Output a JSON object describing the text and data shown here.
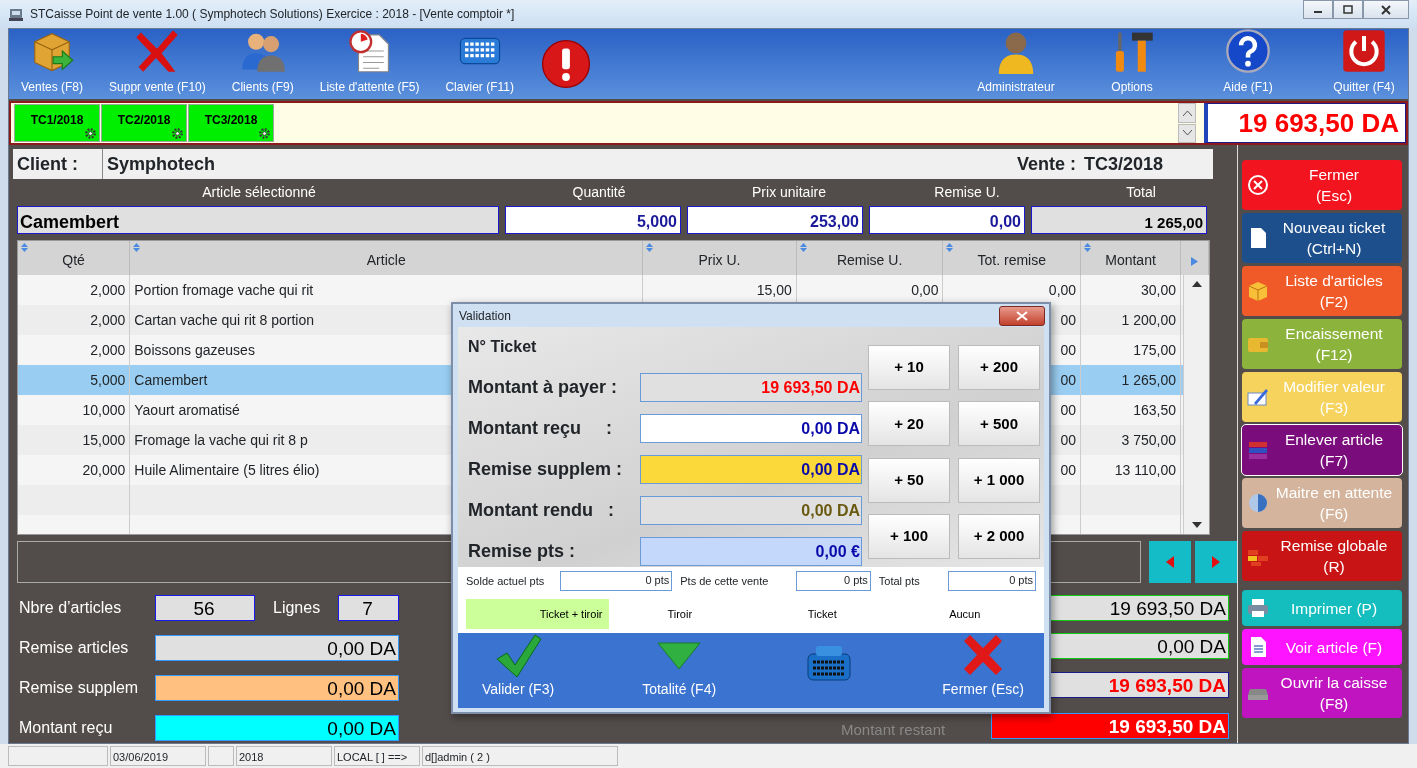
{
  "window": {
    "title": "STCaisse Point de vente 1.00 ( Symphotech Solutions) Exercice : 2018 - [Vente comptoir  *]"
  },
  "toolbar": {
    "left": [
      {
        "label": "Ventes (F8)",
        "kind": "sales"
      },
      {
        "label": "Suppr vente (F10)",
        "kind": "delete"
      },
      {
        "label": "Clients (F9)",
        "kind": "clients"
      },
      {
        "label": "Liste d'attente (F5)",
        "kind": "waiting"
      },
      {
        "label": "Clavier (F11)",
        "kind": "keyboard"
      },
      {
        "kind": "alert"
      }
    ],
    "right": [
      {
        "label": "Administrateur",
        "kind": "admin"
      },
      {
        "label": "Options",
        "kind": "options"
      },
      {
        "label": "Aide (F1)",
        "kind": "help"
      },
      {
        "label": "Quitter (F4)",
        "kind": "quit"
      }
    ]
  },
  "ticket_tabs": [
    {
      "label": "TC1/2018"
    },
    {
      "label": "TC2/2018"
    },
    {
      "label": "TC3/2018"
    }
  ],
  "total_display": "19 693,50 DA",
  "client": {
    "label": "Client :",
    "name": "Symphotech"
  },
  "sale": {
    "label": "Vente :",
    "number": "TC3/2018"
  },
  "article_entry": {
    "headers": [
      "Article sélectionné",
      "Quantité",
      "Prix unitaire",
      "Remise U.",
      "Total"
    ],
    "values": [
      "Camembert",
      "5,000",
      "253,00",
      "0,00",
      "1 265,00"
    ]
  },
  "table": {
    "columns": [
      "Qté",
      "Article",
      "Prix U.",
      "Remise U.",
      "Tot. remise",
      "Montant"
    ],
    "rows": [
      {
        "cells": [
          "2,000",
          "Portion fromage vache qui rit",
          "15,00",
          "0,00",
          "0,00",
          "30,00"
        ],
        "selected": false
      },
      {
        "cells": [
          "2,000",
          "Cartan vache qui rit 8 portion",
          "",
          "",
          "00",
          "1 200,00"
        ],
        "selected": false
      },
      {
        "cells": [
          "2,000",
          "Boissons gazeuses",
          "",
          "",
          "00",
          "175,00"
        ],
        "selected": false
      },
      {
        "cells": [
          "5,000",
          "Camembert",
          "",
          "",
          "00",
          "1 265,00"
        ],
        "selected": true
      },
      {
        "cells": [
          "10,000",
          "Yaourt aromatisé",
          "",
          "",
          "00",
          "163,50"
        ],
        "selected": false
      },
      {
        "cells": [
          "15,000",
          "Fromage la vache qui rit 8 p",
          "",
          "",
          "00",
          "3 750,00"
        ],
        "selected": false
      },
      {
        "cells": [
          "20,000",
          "Huile Alimentaire (5 litres élio)",
          "",
          "",
          "00",
          "13 110,00"
        ],
        "selected": false
      }
    ]
  },
  "summary": {
    "articles_label": "Nbre d’articles",
    "articles_value": "56",
    "lines_label": "Lignes",
    "lines_value": "7",
    "amounts": [
      {
        "label": "Remise articles",
        "value": "0,00 DA",
        "kind": "discount"
      },
      {
        "label": "Remise supplem",
        "value": "0,00 DA",
        "kind": "extra"
      },
      {
        "label": "Montant reçu",
        "value": "0,00 DA",
        "kind": "received"
      }
    ],
    "totals": [
      {
        "value": "19 693,50 DA",
        "kind": "total"
      },
      {
        "value": "0,00 DA",
        "kind": "discount"
      },
      {
        "value": "19 693,50 DA",
        "kind": "net"
      },
      {
        "label": "Montant restant",
        "value": "19 693,50 DA",
        "kind": "remaining"
      }
    ]
  },
  "side_buttons": [
    {
      "label": "Fermer\n(Esc)",
      "kind": "close",
      "color": "#f2141e"
    },
    {
      "label": "Nouveau ticket\n(Ctrl+N)",
      "kind": "new",
      "color": "#1d4f8c"
    },
    {
      "label": "Liste d'articles\n(F2)",
      "kind": "list",
      "color": "#f05a28"
    },
    {
      "label": "Encaissement\n(F12)",
      "kind": "cash",
      "color": "#8cb43c"
    },
    {
      "label": "Modifier valeur\n(F3)",
      "kind": "edit",
      "color": "#f5d35c"
    },
    {
      "label": "Enlever article\n(F7)",
      "kind": "remove",
      "color": "#7b0c7b"
    },
    {
      "label": "Maitre en attente\n(F6)",
      "kind": "hold",
      "color": "#d4b49c"
    },
    {
      "label": "Remise globale\n(R)",
      "kind": "discount",
      "color": "#c81414"
    },
    {
      "label": "Imprimer (P)",
      "kind": "print",
      "color": "#14bebe"
    },
    {
      "label": "Voir article (F)",
      "kind": "view",
      "color": "#ff14ff"
    },
    {
      "label": "Ouvrir la caisse\n(F8)",
      "kind": "drawer",
      "color": "#c014c0"
    }
  ],
  "status_bar": [
    "03/06/2019",
    "2018",
    "LOCAL [  ] ==>",
    "d[]admin ( 2 )"
  ],
  "dialog": {
    "title": "Validation",
    "heading": "N° Ticket",
    "fields": [
      {
        "label": "Montant à payer :",
        "value": "19 693,50 DA",
        "kind": "due"
      },
      {
        "label": "Montant reçu     :",
        "value": "0,00 DA",
        "kind": "received"
      },
      {
        "label": "Remise supplem :",
        "value": "0,00 DA",
        "kind": "extra"
      },
      {
        "label": "Montant rendu   :",
        "value": "0,00 DA",
        "kind": "change"
      },
      {
        "label": "Remise pts :",
        "value": "0,00 €",
        "kind": "points"
      }
    ],
    "quick_buttons": [
      "+ 10",
      "+ 200",
      "+ 20",
      "+ 500",
      "+ 50",
      "+ 1 000",
      "+ 100",
      "+ 2 000"
    ],
    "points": [
      {
        "label": "Solde actuel pts",
        "value": "0 pts"
      },
      {
        "label": "Pts de cette vente",
        "value": "0 pts"
      },
      {
        "label": "Total pts",
        "value": "0 pts"
      }
    ],
    "print_options": [
      {
        "label": "Ticket + tiroir",
        "selected": true
      },
      {
        "label": "Tiroir",
        "selected": false
      },
      {
        "label": "Ticket",
        "selected": false
      },
      {
        "label": "Aucun",
        "selected": false
      }
    ],
    "actions": [
      {
        "label": "Valider (F3)",
        "kind": "validate"
      },
      {
        "label": "Totalité  (F4)",
        "kind": "all"
      },
      {
        "kind": "register"
      },
      {
        "label": "Fermer  (Esc)",
        "kind": "close"
      }
    ]
  }
}
